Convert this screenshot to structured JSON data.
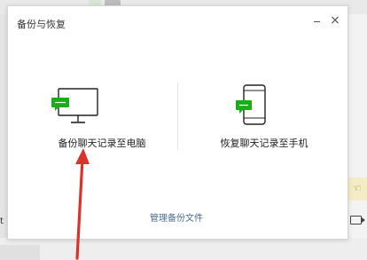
{
  "dialog": {
    "title": "备份与恢复",
    "close_glyph": "×"
  },
  "options": {
    "backup_pc": {
      "label": "备份聊天记录至电脑",
      "icon": "monitor-chat-icon"
    },
    "restore_phone": {
      "label": "恢复聊天记录至手机",
      "icon": "phone-chat-icon"
    }
  },
  "manage_link": "管理备份文件",
  "background": {
    "left_letter": "t",
    "yellow_glyph": "☜"
  },
  "colors": {
    "accent_green": "#1aad19",
    "link": "#4a6a94",
    "arrow": "#d9342b"
  }
}
